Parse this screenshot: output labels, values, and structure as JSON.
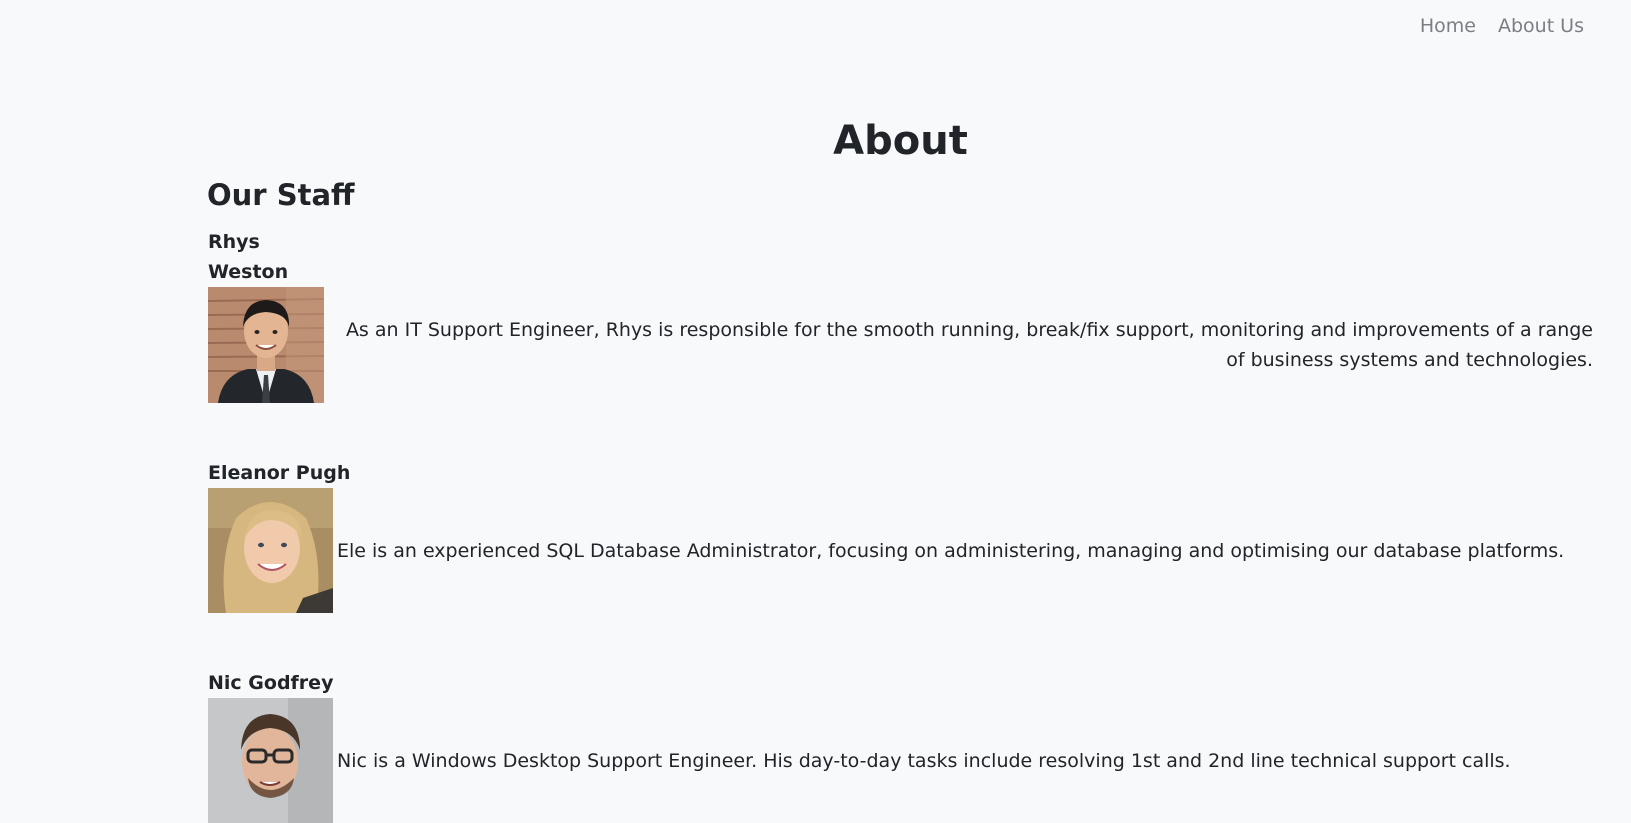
{
  "nav": {
    "links": [
      "Home",
      "About Us"
    ]
  },
  "page": {
    "title": "About",
    "section_title": "Our Staff"
  },
  "staff": [
    {
      "name": "Rhys Weston",
      "bio": "As an IT Support Engineer, Rhys is responsible for the smooth running, break/fix support, monitoring and improvements of a range of business systems and technologies."
    },
    {
      "name": "Eleanor Pugh",
      "bio": "Ele is an experienced SQL Database Administrator, focusing on administering, managing and optimising our database platforms."
    },
    {
      "name": "Nic Godfrey",
      "bio": "Nic is a Windows Desktop Support Engineer. His day-to-day tasks include resolving 1st and 2nd line technical support calls."
    }
  ]
}
